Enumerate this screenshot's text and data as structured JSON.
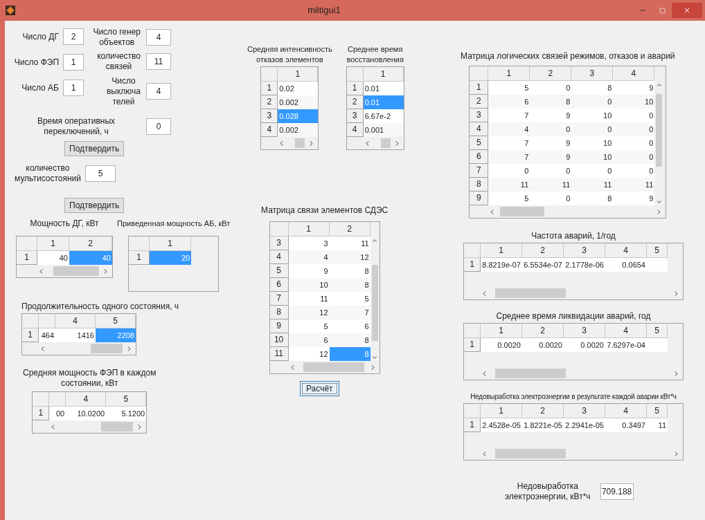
{
  "window": {
    "title": "miltigui1"
  },
  "counts_left": [
    {
      "label": "Число ДГ",
      "value": "2"
    },
    {
      "label": "Число ФЭП",
      "value": "1"
    },
    {
      "label": "Число АБ",
      "value": "1"
    }
  ],
  "counts_right": [
    {
      "label": "Число генер\nобъектов",
      "value": "4"
    },
    {
      "label": "количество\nсвязей",
      "value": "11"
    },
    {
      "label": "Число\nвыключа\nтелей",
      "value": "4"
    }
  ],
  "switch_time": {
    "label": "Время оперативных переключений, ч",
    "value": "0"
  },
  "confirm_button_1": "Подтвердить",
  "multistate": {
    "label": "количество\nмультисостояний",
    "value": "5"
  },
  "confirm_button_2": "Подтвердить",
  "tables": {
    "dg_power": {
      "title": "Мощность ДГ, кВт",
      "columns": [
        "1",
        "2"
      ],
      "rows": [
        {
          "label": "1",
          "cells": [
            {
              "text": "40",
              "selected": false
            },
            {
              "text": "40",
              "selected": true
            }
          ]
        }
      ]
    },
    "ab_power": {
      "title": "Приведенная мощность АБ, кВт",
      "columns": [
        "1"
      ],
      "rows": [
        {
          "label": "1",
          "cells": [
            {
              "text": "20",
              "selected": true
            }
          ]
        }
      ]
    },
    "duration": {
      "title": "Продолжительность одного состояния, ч",
      "columns": [
        "",
        "4",
        "5"
      ],
      "rows": [
        {
          "label": "1",
          "cells": [
            {
              "text": "464",
              "selected": false
            },
            {
              "text": "1416",
              "selected": false
            },
            {
              "text": "2208",
              "selected": true
            }
          ]
        }
      ]
    },
    "fep_power": {
      "title": "Средняя мощность ФЭП в каждом\nсостоянии, кВт",
      "columns": [
        "",
        "4",
        "5"
      ],
      "rows": [
        {
          "label": "1",
          "cells": [
            {
              "text": "00",
              "selected": false
            },
            {
              "text": "10.0200",
              "selected": false
            },
            {
              "text": "5.1200",
              "selected": false
            }
          ]
        }
      ]
    },
    "failure_rate": {
      "title": "Средняя интенсивность\nотказов элементов",
      "columns": [
        "1"
      ],
      "rows": [
        {
          "label": "1",
          "cells": [
            {
              "text": "0.02",
              "selected": false
            }
          ]
        },
        {
          "label": "2",
          "cells": [
            {
              "text": "0.002",
              "selected": false
            }
          ]
        },
        {
          "label": "3",
          "cells": [
            {
              "text": "0.028",
              "selected": true
            }
          ]
        },
        {
          "label": "4",
          "cells": [
            {
              "text": "0.002",
              "selected": false
            }
          ]
        }
      ]
    },
    "recovery_time": {
      "title": "Среднее время\nвосстановления",
      "columns": [
        "1"
      ],
      "rows": [
        {
          "label": "1",
          "cells": [
            {
              "text": "0.01",
              "selected": false
            }
          ]
        },
        {
          "label": "2",
          "cells": [
            {
              "text": "0.01",
              "selected": true
            }
          ]
        },
        {
          "label": "3",
          "cells": [
            {
              "text": "6.67e-2",
              "selected": false
            }
          ]
        },
        {
          "label": "4",
          "cells": [
            {
              "text": "0.001",
              "selected": false
            }
          ]
        }
      ]
    },
    "link_matrix": {
      "title": "Матрица связи элементов СДЭС",
      "columns": [
        "1",
        "2"
      ],
      "rows": [
        {
          "label": "3",
          "cells": [
            {
              "text": "3",
              "selected": false
            },
            {
              "text": "11",
              "selected": false
            }
          ]
        },
        {
          "label": "4",
          "cells": [
            {
              "text": "4",
              "selected": false
            },
            {
              "text": "12",
              "selected": false
            }
          ]
        },
        {
          "label": "5",
          "cells": [
            {
              "text": "9",
              "selected": false
            },
            {
              "text": "8",
              "selected": false
            }
          ]
        },
        {
          "label": "6",
          "cells": [
            {
              "text": "10",
              "selected": false
            },
            {
              "text": "8",
              "selected": false
            }
          ]
        },
        {
          "label": "7",
          "cells": [
            {
              "text": "11",
              "selected": false
            },
            {
              "text": "5",
              "selected": false
            }
          ]
        },
        {
          "label": "8",
          "cells": [
            {
              "text": "12",
              "selected": false
            },
            {
              "text": "7",
              "selected": false
            }
          ]
        },
        {
          "label": "9",
          "cells": [
            {
              "text": "5",
              "selected": false
            },
            {
              "text": "6",
              "selected": false
            }
          ]
        },
        {
          "label": "10",
          "cells": [
            {
              "text": "6",
              "selected": false
            },
            {
              "text": "8",
              "selected": false
            }
          ]
        },
        {
          "label": "11",
          "cells": [
            {
              "text": "12",
              "selected": false
            },
            {
              "text": "8",
              "selected": true
            }
          ]
        }
      ]
    },
    "logic_matrix": {
      "title": "Матрица логических связей режимов, отказов и аварий",
      "columns": [
        "1",
        "2",
        "3",
        "4"
      ],
      "rows": [
        {
          "label": "1",
          "cells": [
            {
              "text": "5",
              "selected": false
            },
            {
              "text": "0",
              "selected": false
            },
            {
              "text": "8",
              "selected": false
            },
            {
              "text": "9",
              "selected": false
            }
          ]
        },
        {
          "label": "2",
          "cells": [
            {
              "text": "6",
              "selected": false
            },
            {
              "text": "8",
              "selected": false
            },
            {
              "text": "0",
              "selected": false
            },
            {
              "text": "10",
              "selected": false
            }
          ]
        },
        {
          "label": "3",
          "cells": [
            {
              "text": "7",
              "selected": false
            },
            {
              "text": "9",
              "selected": false
            },
            {
              "text": "10",
              "selected": false
            },
            {
              "text": "0",
              "selected": false
            }
          ]
        },
        {
          "label": "4",
          "cells": [
            {
              "text": "4",
              "selected": false
            },
            {
              "text": "0",
              "selected": false
            },
            {
              "text": "0",
              "selected": false
            },
            {
              "text": "0",
              "selected": false
            }
          ]
        },
        {
          "label": "5",
          "cells": [
            {
              "text": "7",
              "selected": false
            },
            {
              "text": "9",
              "selected": false
            },
            {
              "text": "10",
              "selected": false
            },
            {
              "text": "0",
              "selected": false
            }
          ]
        },
        {
          "label": "6",
          "cells": [
            {
              "text": "7",
              "selected": false
            },
            {
              "text": "9",
              "selected": false
            },
            {
              "text": "10",
              "selected": false
            },
            {
              "text": "0",
              "selected": false
            }
          ]
        },
        {
          "label": "7",
          "cells": [
            {
              "text": "0",
              "selected": false
            },
            {
              "text": "0",
              "selected": false
            },
            {
              "text": "0",
              "selected": false
            },
            {
              "text": "0",
              "selected": false
            }
          ]
        },
        {
          "label": "8",
          "cells": [
            {
              "text": "11",
              "selected": false
            },
            {
              "text": "11",
              "selected": false
            },
            {
              "text": "11",
              "selected": false
            },
            {
              "text": "11",
              "selected": false
            }
          ]
        },
        {
          "label": "9",
          "cells": [
            {
              "text": "5",
              "selected": false
            },
            {
              "text": "0",
              "selected": false
            },
            {
              "text": "8",
              "selected": false
            },
            {
              "text": "9",
              "selected": false
            }
          ]
        }
      ]
    },
    "accident_rate": {
      "title": "Частота аварий, 1/год",
      "columns": [
        "1",
        "2",
        "3",
        "4",
        "5"
      ],
      "rows": [
        {
          "label": "1",
          "cells": [
            {
              "text": "8.8219e-07",
              "selected": false
            },
            {
              "text": "6.5534e-07",
              "selected": false
            },
            {
              "text": "2.1778e-06",
              "selected": false
            },
            {
              "text": "0.0654",
              "selected": false
            }
          ]
        }
      ]
    },
    "liquidation_time": {
      "title": "Среднее время ликвидации аварий, год",
      "columns": [
        "1",
        "2",
        "3",
        "4",
        "5"
      ],
      "rows": [
        {
          "label": "1",
          "cells": [
            {
              "text": "0.0020",
              "selected": false
            },
            {
              "text": "0.0020",
              "selected": false
            },
            {
              "text": "0.0020",
              "selected": false
            },
            {
              "text": "7.6297e-04",
              "selected": false
            }
          ]
        }
      ]
    },
    "energy_loss": {
      "title": "Недовыработка электроэнергии в результате каждой аварии кВт*ч",
      "columns": [
        "1",
        "2",
        "3",
        "4",
        "5"
      ],
      "rows": [
        {
          "label": "1",
          "cells": [
            {
              "text": "2.4528e-05",
              "selected": false
            },
            {
              "text": "1.8221e-05",
              "selected": false
            },
            {
              "text": "2.2941e-05",
              "selected": false
            },
            {
              "text": "0.3497",
              "selected": false
            },
            {
              "text": "11",
              "selected": false
            }
          ]
        }
      ]
    }
  },
  "calc_button": "Расчёт",
  "result": {
    "label": "Недовыработка\nэлектроэнергии, кВт*ч",
    "value": "709.188"
  }
}
